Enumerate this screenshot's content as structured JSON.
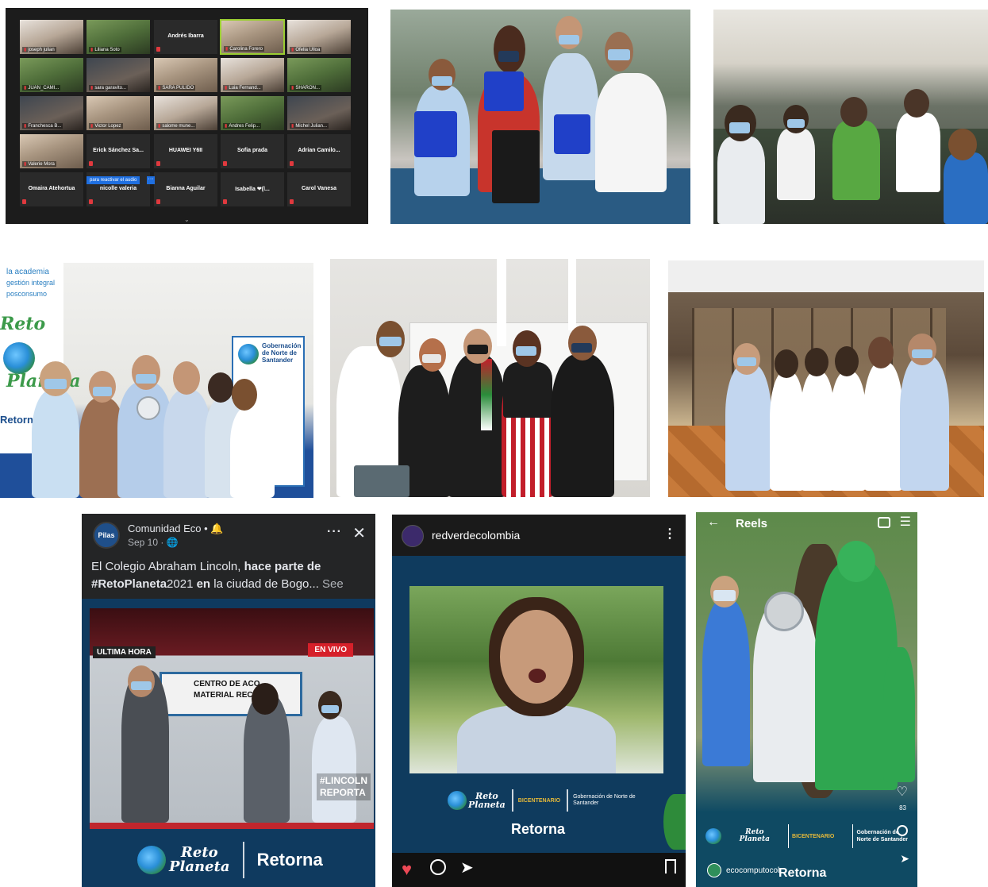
{
  "zoom": {
    "participants": [
      {
        "name": "joseph julian",
        "cam": "video"
      },
      {
        "name": "Liliana Soto",
        "cam": "video"
      },
      {
        "name": "Andrés Ibarra",
        "cam": "off"
      },
      {
        "name": "Carolina Forero",
        "cam": "video"
      },
      {
        "name": "Ofelia Ulloa",
        "cam": "video"
      },
      {
        "name": "JUAN_CAMI...",
        "cam": "video"
      },
      {
        "name": "sara garavito...",
        "cam": "video"
      },
      {
        "name": "SARA PULIDO",
        "cam": "video"
      },
      {
        "name": "Luia Fernand...",
        "cam": "video"
      },
      {
        "name": "SHARON...",
        "cam": "video"
      },
      {
        "name": "Franchesca B...",
        "cam": "video"
      },
      {
        "name": "Victor Lopez",
        "cam": "video"
      },
      {
        "name": "salome mune...",
        "cam": "video"
      },
      {
        "name": "Andres Felip...",
        "cam": "video"
      },
      {
        "name": "Michel Julian...",
        "cam": "video"
      },
      {
        "name": "Valerie Mora",
        "cam": "video"
      },
      {
        "name": "Erick Sánchez Sa...",
        "cam": "off"
      },
      {
        "name": "HUAWEI Y6II",
        "cam": "off"
      },
      {
        "name": "Sofia prada",
        "cam": "off"
      },
      {
        "name": "Adrian Camilo...",
        "cam": "off"
      },
      {
        "name": "Omaira Atehortua",
        "cam": "off"
      },
      {
        "name": "nicolle valeria",
        "cam": "off"
      },
      {
        "name": "Bianna Aguilar",
        "cam": "off"
      },
      {
        "name": "Isabella ❤(l...",
        "cam": "off"
      },
      {
        "name": "Carol Vanesa",
        "cam": "off"
      }
    ],
    "tooltip": "para reactivar el audio",
    "more": "···",
    "chevron": "⌄"
  },
  "facebook_post": {
    "avatar_text": "Pilas",
    "page_name": "Comunidad Eco • 🔔",
    "time": "Sep 10 · 🌐",
    "menu": "···",
    "close": "✕",
    "text_pre": "El Colegio Abraham Lincoln, ",
    "text_bold1": "hace parte de",
    "text_bold2": "#RetoPlaneta",
    "text_mid": "2021 ",
    "text_bold3": "en",
    "text_post": " la ciudad de Bogo...",
    "see_more": "See more",
    "video": {
      "ultima_hora": "ULTIMA HORA",
      "en_vivo": "EN VIVO",
      "sign": "CENTRO DE ACO... MATERIAL RECI...",
      "hashtag_line1": "#LINCOLN",
      "hashtag_line2": "REPORTA"
    },
    "logo_reto_line1": "Reto",
    "logo_reto_line2": "Planeta",
    "logo_retorna": "Retorna"
  },
  "instagram_post": {
    "username": "redverdecolombia",
    "menu": "⋮",
    "logo_reto_line1": "Reto",
    "logo_reto_line2": "Planeta",
    "logo_bicentenario": "BICENTENARIO",
    "logo_gobernacion": "Gobernación de Norte de Santander",
    "logo_retorna": "Retorna",
    "heart": "♥",
    "share": "➤"
  },
  "reels": {
    "title": "Reels",
    "back": "←",
    "menu": "☰",
    "likes": "83",
    "username": "ecocomputocol",
    "heart": "♡",
    "share": "➤",
    "logo_reto_line1": "Reto",
    "logo_reto_line2": "Planeta",
    "logo_bicentenario": "BICENTENARIO",
    "logo_gobernacion": "Gobernación de Norte de Santander",
    "logo_retorna": "Retorna"
  },
  "photos": {
    "gobernacion_banner": "Gobernación de Norte de Santander",
    "reto_banner_line1": "Reto",
    "reto_banner_line2": "Planeta",
    "retorna_banner": "Retorna",
    "academia_text": "la academia",
    "gestion_text": "gestión integral",
    "posconsumo_text": "posconsumo",
    "reto_floor_text": "Reto"
  },
  "colors": {
    "zoom_bg": "#1c1c1c",
    "brand_blue": "#0f3b5e",
    "live_red": "#d6202a",
    "ig_heart": "#ed4956"
  }
}
